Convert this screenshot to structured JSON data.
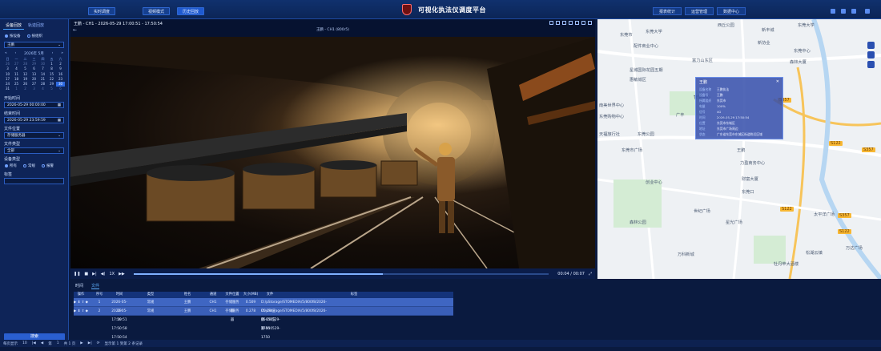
{
  "header": {
    "title": "可视化执法仪调度平台",
    "nav_left": [
      "实时调度",
      "视频模式",
      "历史回放"
    ],
    "nav_left_active": 2,
    "nav_right": [
      "报表统计",
      "运营管理",
      "数据中心"
    ]
  },
  "sidebar": {
    "tabs": [
      "设备回放",
      "轨迹回放"
    ],
    "active_tab": 0,
    "radio": [
      "按设备",
      "按组织"
    ],
    "radio_selected": 0,
    "device_select": "王鹏",
    "calendar": {
      "title": "2026年 5月",
      "weekdays": [
        "日",
        "一",
        "二",
        "三",
        "四",
        "五",
        "六"
      ],
      "days": [
        "26",
        "27",
        "28",
        "29",
        "30",
        "1",
        "2",
        "3",
        "4",
        "5",
        "6",
        "7",
        "8",
        "9",
        "10",
        "11",
        "12",
        "13",
        "14",
        "15",
        "16",
        "17",
        "18",
        "19",
        "20",
        "21",
        "22",
        "23",
        "24",
        "25",
        "26",
        "27",
        "28",
        "29",
        "30",
        "31",
        "1",
        "2",
        "3",
        "4",
        "5",
        "6"
      ],
      "selected_index": 34
    },
    "start_label": "开始时间",
    "start_value": "2026-05-29 00:00:00",
    "end_label": "结束时间",
    "end_value": "2026-05-29 23:59:59",
    "location_label": "文件位置",
    "location_value": "存储服务器",
    "filetype_label": "文件类型",
    "filetype_value": "全部",
    "equip_label": "设备类型",
    "equip_options": [
      "所有",
      "常规",
      "报警"
    ],
    "tag_label": "标签",
    "search_button": "搜索"
  },
  "video": {
    "header_title": "王鹏 - CH1 - 2026-05-29 17:00:51 - 17:50:54",
    "sub_title": "王鹏 - CH1 (800r5)",
    "time_readout": "00:04 / 00:07",
    "speed": "1X",
    "progress": 0.6
  },
  "map": {
    "labels": [
      "东莞市",
      "西丘公园",
      "新丰城",
      "东莞大学",
      "新协业",
      "东莞大学",
      "东莞中心",
      "配件商业中心",
      "富力山东区",
      "森林大厦",
      "星城国际花园五期",
      "惠敏城区",
      "智慧中心",
      "南美世界中心",
      "广丰",
      "东莞购物中心",
      "东湖小区",
      "东莞公园",
      "天福旅行社",
      "东莞市广场",
      "王鹏",
      "财富大厦",
      "东莞口",
      "力盈商务中心",
      "创业中心",
      "万科新城",
      "世纪广场",
      "森林公园",
      "星光广场",
      "太平洋广场",
      "万达广场",
      "松湖云镇",
      "牡丹苹大酒楼"
    ],
    "roads": [
      "S357",
      "S122",
      "S122",
      "S357",
      "S357",
      "S122"
    ],
    "popup": {
      "title": "王鹏",
      "rows": [
        {
          "k": "设备名称",
          "v": "王鹏执法"
        },
        {
          "k": "设备号",
          "v": "王鹏"
        },
        {
          "k": "所属组织",
          "v": "东莞市"
        },
        {
          "k": "电量",
          "v": "100%"
        },
        {
          "k": "信号",
          "v": "4G"
        },
        {
          "k": "时间",
          "v": "2026-05-29 17:50:54"
        },
        {
          "k": "位置",
          "v": "东莞市东城区"
        },
        {
          "k": "地址",
          "v": "东莞市广场周边"
        },
        {
          "k": "状态",
          "v": "广东省东莞市东城区街道附近区域"
        }
      ]
    }
  },
  "bottom": {
    "tabs": [
      "时间",
      "文件"
    ],
    "active_tab": 1,
    "columns": [
      "操作",
      "序号",
      "时间",
      "类型",
      "姓名",
      "通道",
      "文件位置",
      "大小(MB)",
      "文件",
      "",
      "标签"
    ],
    "rows": [
      [
        "",
        "1",
        "2026-05-29 17:50:51 - 17:50:54",
        "常规",
        "王鹏",
        "CH1",
        "存储服务器",
        "0.509",
        "D:/pStorage/STOMEDIA/5/800f8/2026-05-29/王鹏-050529-1750",
        ""
      ],
      [
        "",
        "2",
        "2026-05-29 17:50:58 - 17:51:06",
        "常规",
        "王鹏",
        "CH1",
        "存储服务器",
        "0.278",
        "D:/pStorage/STOMEDIA/5/800f8/2026-05-29/王鹏-050529-1750",
        ""
      ]
    ],
    "pager": {
      "per_page_label": "每页显示",
      "per_page": "10",
      "page_label": "第",
      "page": "1",
      "total_label": "共 1 页",
      "summary": "显示第 1 到第 2 条记录"
    }
  },
  "colors": {
    "bg": "#0a1a3f",
    "accent": "#2e6ae0",
    "header": "#10316e"
  }
}
